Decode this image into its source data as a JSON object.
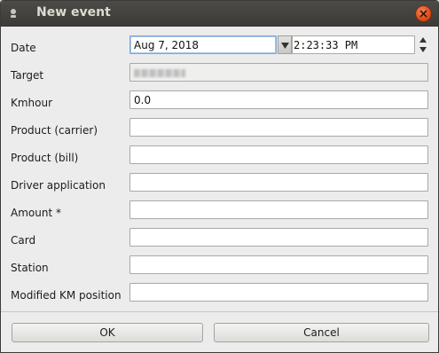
{
  "window": {
    "title": "New event"
  },
  "form": {
    "rows": [
      {
        "label": "Date",
        "value": "Aug 7, 2018",
        "time": "2:23:33 PM"
      },
      {
        "label": "Target",
        "value": ""
      },
      {
        "label": "Kmhour",
        "value": "0.0"
      },
      {
        "label": "Product (carrier)",
        "value": ""
      },
      {
        "label": "Product (bill)",
        "value": ""
      },
      {
        "label": "Driver application",
        "value": ""
      },
      {
        "label": "Amount *",
        "value": ""
      },
      {
        "label": "Card",
        "value": ""
      },
      {
        "label": "Station",
        "value": ""
      },
      {
        "label": "Modified KM position",
        "value": ""
      }
    ]
  },
  "buttons": {
    "ok": "OK",
    "cancel": "Cancel"
  },
  "colors": {
    "titlebar": "#3b3a36",
    "close": "#df4b16",
    "focus_border": "#7ba7d6"
  }
}
